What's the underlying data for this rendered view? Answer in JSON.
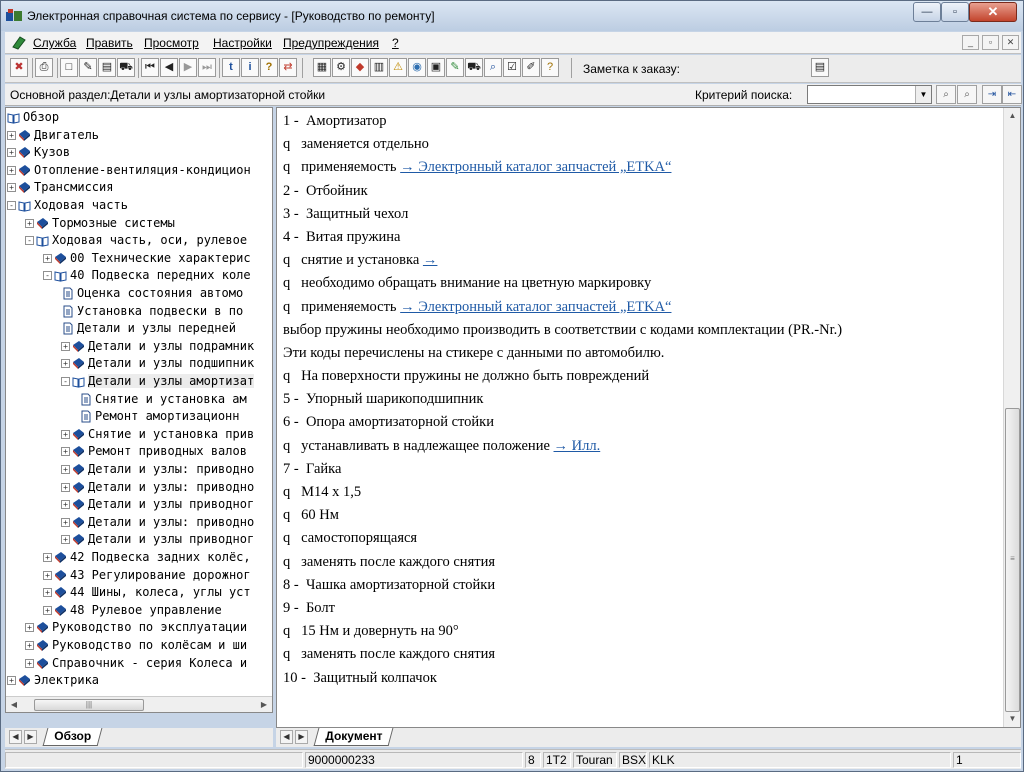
{
  "window": {
    "title": "Электронная справочная система по сервису - [Руководство по ремонту]"
  },
  "menu": [
    "Служба",
    "Править",
    "Просмотр",
    "Настройки",
    "Предупреждения",
    "?"
  ],
  "toolbar": {
    "note_label": "Заметка к заказу:"
  },
  "criteria": {
    "section_label": "Основной раздел:Детали и узлы амортизаторной стойки",
    "search_label": "Критерий  поиска:",
    "search_value": ""
  },
  "tree": [
    {
      "label": "Обзор",
      "level": 0,
      "expander": "",
      "icon": "open-book-icon"
    },
    {
      "label": "Двигатель",
      "level": 0,
      "expander": "+",
      "icon": "closed-book-icon"
    },
    {
      "label": "Кузов",
      "level": 0,
      "expander": "+",
      "icon": "closed-book-icon"
    },
    {
      "label": "Отопление-вентиляция-кондицион",
      "level": 0,
      "expander": "+",
      "icon": "closed-book-icon"
    },
    {
      "label": "Трансмиссия",
      "level": 0,
      "expander": "+",
      "icon": "closed-book-icon"
    },
    {
      "label": "Ходовая часть",
      "level": 0,
      "expander": "-",
      "icon": "open-book-icon"
    },
    {
      "label": "Тормозные системы",
      "level": 1,
      "expander": "+",
      "icon": "closed-book-icon"
    },
    {
      "label": "Ходовая часть, оси, рулевое",
      "level": 1,
      "expander": "-",
      "icon": "open-book-icon"
    },
    {
      "label": "00 Технические характерис",
      "level": 2,
      "expander": "+",
      "icon": "closed-book-icon"
    },
    {
      "label": "40 Подвеска передних коле",
      "level": 2,
      "expander": "-",
      "icon": "open-book-icon"
    },
    {
      "label": "Оценка состояния автомо",
      "level": 3,
      "expander": "",
      "icon": "page-icon"
    },
    {
      "label": "Установка подвески в по",
      "level": 3,
      "expander": "",
      "icon": "page-icon"
    },
    {
      "label": "Детали и узлы передней",
      "level": 3,
      "expander": "",
      "icon": "page-icon"
    },
    {
      "label": "Детали и узлы подрамник",
      "level": 3,
      "expander": "+",
      "icon": "closed-book-icon"
    },
    {
      "label": "Детали и узлы подшипник",
      "level": 3,
      "expander": "+",
      "icon": "closed-book-icon"
    },
    {
      "label": "Детали и узлы амортизат",
      "level": 3,
      "expander": "-",
      "icon": "open-book-icon",
      "selected": true
    },
    {
      "label": "Снятие и установка ам",
      "level": 4,
      "expander": "",
      "icon": "page-icon"
    },
    {
      "label": "Ремонт амортизационн",
      "level": 4,
      "expander": "",
      "icon": "page-icon"
    },
    {
      "label": "Снятие и установка прив",
      "level": 3,
      "expander": "+",
      "icon": "closed-book-icon"
    },
    {
      "label": "Ремонт приводных валов",
      "level": 3,
      "expander": "+",
      "icon": "closed-book-icon"
    },
    {
      "label": "Детали и узлы: приводно",
      "level": 3,
      "expander": "+",
      "icon": "closed-book-icon"
    },
    {
      "label": "Детали и узлы: приводно",
      "level": 3,
      "expander": "+",
      "icon": "closed-book-icon"
    },
    {
      "label": "Детали и узлы приводног",
      "level": 3,
      "expander": "+",
      "icon": "closed-book-icon"
    },
    {
      "label": "Детали и узлы: приводно",
      "level": 3,
      "expander": "+",
      "icon": "closed-book-icon"
    },
    {
      "label": "Детали и узлы приводног",
      "level": 3,
      "expander": "+",
      "icon": "closed-book-icon"
    },
    {
      "label": "42 Подвеска задних колёс,",
      "level": 2,
      "expander": "+",
      "icon": "closed-book-icon"
    },
    {
      "label": "43 Регулирование дорожног",
      "level": 2,
      "expander": "+",
      "icon": "closed-book-icon"
    },
    {
      "label": "44 Шины, колеса, углы уст",
      "level": 2,
      "expander": "+",
      "icon": "closed-book-icon"
    },
    {
      "label": "48 Рулевое управление",
      "level": 2,
      "expander": "+",
      "icon": "closed-book-icon"
    },
    {
      "label": "Руководство по эксплуатации",
      "level": 1,
      "expander": "+",
      "icon": "closed-book-icon"
    },
    {
      "label": "Руководство по колёсам и ши",
      "level": 1,
      "expander": "+",
      "icon": "closed-book-icon"
    },
    {
      "label": "Справочник - серия Колеса и",
      "level": 1,
      "expander": "+",
      "icon": "closed-book-icon"
    },
    {
      "label": "Электрика",
      "level": 0,
      "expander": "+",
      "icon": "closed-book-icon"
    }
  ],
  "tabs": {
    "left": "Обзор",
    "right": "Документ"
  },
  "document": [
    {
      "text": "1 -  Амортизатор"
    },
    {
      "text": "q   заменяется отдельно"
    },
    {
      "text": "q   применяемость ",
      "link": "→ Электронный каталог запчастей „ETKA“"
    },
    {
      "text": "2 -  Отбойник"
    },
    {
      "text": "3 -  Защитный чехол"
    },
    {
      "text": "4 -  Витая пружина"
    },
    {
      "text": "q   снятие и установка ",
      "link": "→"
    },
    {
      "text": "q   необходимо обращать внимание на цветную маркировку"
    },
    {
      "text": "q   применяемость ",
      "link": "→ Электронный каталог запчастей „ETKA“"
    },
    {
      "text": "выбор пружины необходимо производить в соответствии с кодами комплектации (PR.-Nr.)"
    },
    {
      "text": "Эти коды перечислены на стикере с данными по автомобилю."
    },
    {
      "text": "q   На поверхности пружины не должно быть повреждений"
    },
    {
      "text": "5 -  Упорный шарикоподшипник"
    },
    {
      "text": "6 -  Опора амортизаторной стойки"
    },
    {
      "text": "q   устанавливать в надлежащее положение ",
      "link": "→ Илл."
    },
    {
      "text": "7 -  Гайка"
    },
    {
      "text": "q   M14 x 1,5"
    },
    {
      "text": "q   60 Нм"
    },
    {
      "text": "q   самостопорящаяся"
    },
    {
      "text": "q   заменять после каждого снятия"
    },
    {
      "text": "8 -  Чашка амортизаторной стойки"
    },
    {
      "text": "9 -  Болт"
    },
    {
      "text": "q   15 Нм и довернуть на 90°"
    },
    {
      "text": "q   заменять после каждого снятия"
    },
    {
      "text": "10 -  Защитный колпачок"
    }
  ],
  "status": {
    "code": "9000000233",
    "f1": "8",
    "f2": "1T2",
    "f3": "Touran",
    "f4": "BSX",
    "f5": "KLK",
    "page": "1"
  },
  "colors": {
    "link": "#1f5aa6",
    "book": "#1d4f9c",
    "page_icon": "#2a4d8a",
    "close_button": "#c3442d"
  }
}
